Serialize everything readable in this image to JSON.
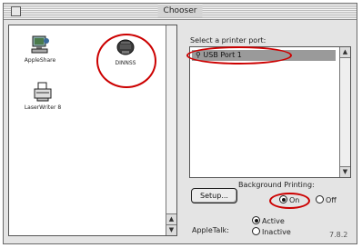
{
  "window": {
    "title": "Chooser"
  },
  "icons": [
    {
      "label": "AppleShare"
    },
    {
      "label": "DINNSS"
    },
    {
      "label": "LaserWriter 8"
    }
  ],
  "port_panel": {
    "label": "Select a printer port:",
    "items": [
      "USB Port 1"
    ]
  },
  "setup": {
    "label": "Setup..."
  },
  "background_printing": {
    "label": "Background Printing:",
    "options": [
      "On",
      "Off"
    ],
    "selected": "On"
  },
  "appletalk": {
    "label": "AppleTalk:",
    "options": [
      "Active",
      "Inactive"
    ],
    "selected": "Active"
  },
  "version": "7.8.2",
  "annotation_color": "#cc0000"
}
